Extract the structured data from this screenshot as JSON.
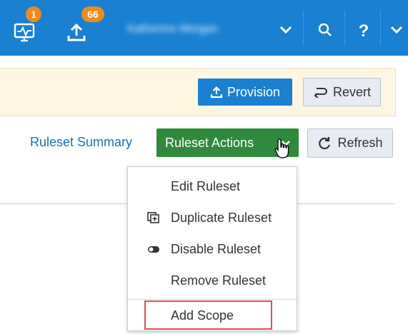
{
  "topbar": {
    "monitor_badge": "1",
    "upload_badge": "66",
    "user_name": "Katherine Morgan",
    "icons": [
      "monitor-icon",
      "upload-icon",
      "chevron-down-icon",
      "search-icon",
      "help-icon",
      "chevron-down-icon"
    ]
  },
  "notice": {
    "provision_label": "Provision",
    "revert_label": "Revert"
  },
  "toolbar": {
    "summary_link": "Ruleset Summary",
    "actions_label": "Ruleset Actions",
    "refresh_label": "Refresh"
  },
  "menu": {
    "items": [
      {
        "label": "Edit Ruleset",
        "icon": ""
      },
      {
        "label": "Duplicate Ruleset",
        "icon": "duplicate-icon"
      },
      {
        "label": "Disable Ruleset",
        "icon": "toggle-icon"
      },
      {
        "label": "Remove Ruleset",
        "icon": ""
      },
      {
        "label": "Add Scope",
        "icon": ""
      }
    ]
  },
  "colors": {
    "topbar": "#1a80d2",
    "provision_button": "#1a80d2",
    "actions_button": "#2f8a3c",
    "notice_bg": "#fdf6e3",
    "highlight": "#d9534f",
    "badge": "#f08a1a"
  }
}
